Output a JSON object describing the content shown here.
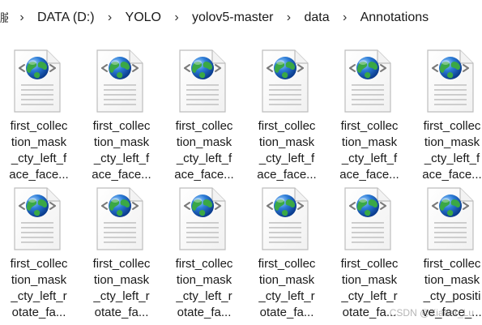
{
  "breadcrumb": {
    "prefix": "脑",
    "items": [
      "DATA (D:)",
      "YOLO",
      "yolov5-master",
      "data",
      "Annotations"
    ],
    "separator": "›"
  },
  "files": [
    {
      "line1": "first_collec",
      "line2": "tion_mask",
      "line3": "_cty_left_f",
      "line4": "ace_face..."
    },
    {
      "line1": "first_collec",
      "line2": "tion_mask",
      "line3": "_cty_left_f",
      "line4": "ace_face..."
    },
    {
      "line1": "first_collec",
      "line2": "tion_mask",
      "line3": "_cty_left_f",
      "line4": "ace_face..."
    },
    {
      "line1": "first_collec",
      "line2": "tion_mask",
      "line3": "_cty_left_f",
      "line4": "ace_face..."
    },
    {
      "line1": "first_collec",
      "line2": "tion_mask",
      "line3": "_cty_left_f",
      "line4": "ace_face..."
    },
    {
      "line1": "first_collec",
      "line2": "tion_mask",
      "line3": "_cty_left_f",
      "line4": "ace_face..."
    },
    {
      "line1": "first_collec",
      "line2": "tion_mask",
      "line3": "_cty_left_r",
      "line4": "otate_fa..."
    },
    {
      "line1": "first_collec",
      "line2": "tion_mask",
      "line3": "_cty_left_r",
      "line4": "otate_fa..."
    },
    {
      "line1": "first_collec",
      "line2": "tion_mask",
      "line3": "_cty_left_r",
      "line4": "otate_fa..."
    },
    {
      "line1": "first_collec",
      "line2": "tion_mask",
      "line3": "_cty_left_r",
      "line4": "otate_fa..."
    },
    {
      "line1": "first_collec",
      "line2": "tion_mask",
      "line3": "_cty_left_r",
      "line4": "otate_fa..."
    },
    {
      "line1": "first_collec",
      "line2": "tion_mask",
      "line3": "_cty_positi",
      "line4": "ve_face_..."
    }
  ],
  "file_icon": "xml-document-globe-icon",
  "watermark": "CSDN @Xiaoer_Lu",
  "colors": {
    "globe_blue": "#2b7bd6",
    "globe_green": "#3aa845",
    "page_border": "#bdbdbd"
  }
}
